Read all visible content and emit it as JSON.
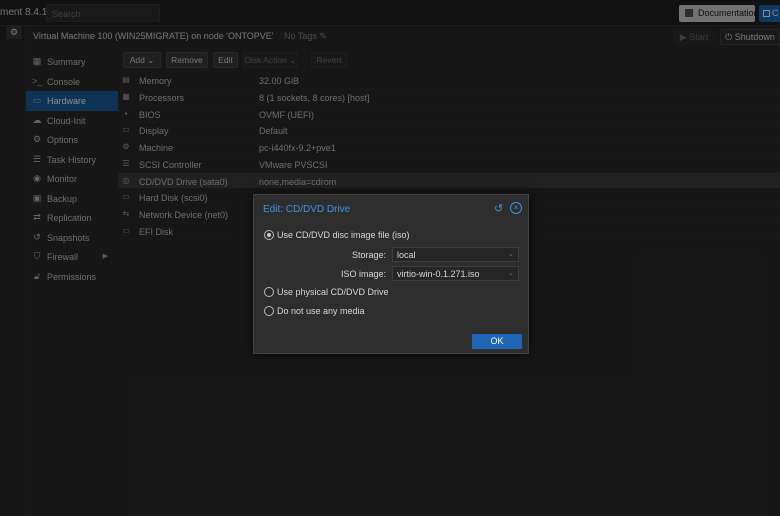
{
  "header": {
    "app_title": "ment 8.4.1",
    "search_placeholder": "Search",
    "documentation_label": "Documentation",
    "create_label": "C"
  },
  "vm": {
    "title": "Virtual Machine 100 (WIN25MIGRATE) on node 'ONTOPVE'",
    "tags": "No Tags",
    "start_label": "Start",
    "shutdown_label": "Shutdown"
  },
  "sidebar": {
    "items": [
      {
        "label": "Summary",
        "icon": "summary-icon"
      },
      {
        "label": "Console",
        "icon": "console-icon"
      },
      {
        "label": "Hardware",
        "icon": "monitor-icon",
        "active": true
      },
      {
        "label": "Cloud-Init",
        "icon": "cloud-icon"
      },
      {
        "label": "Options",
        "icon": "gear-icon"
      },
      {
        "label": "Task History",
        "icon": "list-icon"
      },
      {
        "label": "Monitor",
        "icon": "eye-icon"
      },
      {
        "label": "Backup",
        "icon": "floppy-icon"
      },
      {
        "label": "Replication",
        "icon": "retweet-icon"
      },
      {
        "label": "Snapshots",
        "icon": "history-icon"
      },
      {
        "label": "Firewall",
        "icon": "shield-icon"
      },
      {
        "label": "Permissions",
        "icon": "unlock-icon"
      }
    ]
  },
  "toolbar": {
    "add_label": "Add",
    "remove_label": "Remove",
    "edit_label": "Edit",
    "disk_action_label": "Disk Action",
    "revert_label": "Revert"
  },
  "hardware": [
    {
      "key": "Memory",
      "value": "32.00 GiB",
      "icon": "memory-icon"
    },
    {
      "key": "Processors",
      "value": "8 (1 sockets, 8 cores) [host]",
      "icon": "cpu-icon"
    },
    {
      "key": "BIOS",
      "value": "OVMF (UEFI)",
      "icon": "chip-icon"
    },
    {
      "key": "Display",
      "value": "Default",
      "icon": "desktop-icon"
    },
    {
      "key": "Machine",
      "value": "pc-i440fx-9.2+pve1",
      "icon": "cogs-icon"
    },
    {
      "key": "SCSI Controller",
      "value": "VMware PVSCSI",
      "icon": "database-icon"
    },
    {
      "key": "CD/DVD Drive (sata0)",
      "value": "none,media=cdrom",
      "icon": "cdrom-icon",
      "selected": true
    },
    {
      "key": "Hard Disk (scsi0)",
      "value": "",
      "icon": "hdd-icon"
    },
    {
      "key": "Network Device (net0)",
      "value": "",
      "icon": "network-icon"
    },
    {
      "key": "EFI Disk",
      "value": "",
      "icon": "hdd-icon"
    }
  ],
  "dialog": {
    "title": "Edit: CD/DVD Drive",
    "option_iso": "Use CD/DVD disc image file (iso)",
    "storage_label": "Storage:",
    "storage_value": "local",
    "iso_label": "ISO image:",
    "iso_value": "virtio-win-0.1.271.iso",
    "option_physical": "Use physical CD/DVD Drive",
    "option_none": "Do not use any media",
    "ok_label": "OK"
  },
  "colors": {
    "accent": "#1d66b5",
    "dialog_title": "#3f93e8",
    "background": "#2b2b2b"
  }
}
